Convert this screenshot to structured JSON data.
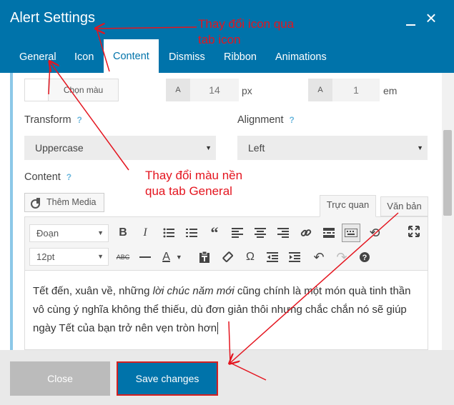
{
  "dialog": {
    "title": "Alert Settings"
  },
  "tabs": [
    {
      "label": "General"
    },
    {
      "label": "Icon"
    },
    {
      "label": "Content",
      "active": true
    },
    {
      "label": "Dismiss"
    },
    {
      "label": "Ribbon"
    },
    {
      "label": "Animations"
    }
  ],
  "color_picker": {
    "button_label": "Chọn màu"
  },
  "font_size": {
    "prefix": "A",
    "value": "14",
    "unit": "px"
  },
  "line_height": {
    "prefix": "A",
    "value": "1",
    "unit": "em"
  },
  "transform": {
    "label": "Transform",
    "help": "?",
    "value": "Uppercase"
  },
  "alignment": {
    "label": "Alignment",
    "help": "?",
    "value": "Left"
  },
  "content_field": {
    "label": "Content",
    "help": "?"
  },
  "add_media": {
    "label": "Thêm Media"
  },
  "editor_tabs": {
    "visual": "Trực quan",
    "text": "Văn bản"
  },
  "toolbar": {
    "format_select": "Đoạn",
    "size_select": "12pt",
    "icons_row1": [
      "bold-icon",
      "italic-icon",
      "bullet-list-icon",
      "numbered-list-icon",
      "blockquote-icon",
      "align-left-icon",
      "align-center-icon",
      "align-right-icon",
      "link-icon",
      "read-more-icon",
      "toolbar-toggle-icon",
      "refresh-icon",
      "fullscreen-icon"
    ],
    "icons_row2": [
      "strikethrough-icon",
      "horizontal-line-icon",
      "text-color-icon",
      "paste-text-icon",
      "clear-formatting-icon",
      "special-character-icon",
      "outdent-icon",
      "indent-icon",
      "undo-icon",
      "redo-icon",
      "help-icon"
    ],
    "bold": "B",
    "italic": "I",
    "strike": "ABC",
    "text_color": "A",
    "omega": "Ω"
  },
  "editor": {
    "text_before": "Tết đến, xuân về, những ",
    "text_italic": "lời chúc năm mới",
    "text_after": " cũng chính là một món quà tinh thần vô cùng ý nghĩa không thể thiếu, dù đơn giản thôi nhưng chắc chắn nó sẽ giúp ngày Tết của bạn trở nên vẹn tròn hơn"
  },
  "footer": {
    "close_label": "Close",
    "save_label": "Save changes"
  },
  "annotations": {
    "icon_note": "Thay đổi icon qua\ntab icon",
    "bg_note": "Thay đổi màu nền\nqua tab General",
    "color": "#e4151f"
  },
  "colors": {
    "header": "#0073aa",
    "accent_border": "#8cc8e8",
    "annotation": "#e4151f"
  }
}
